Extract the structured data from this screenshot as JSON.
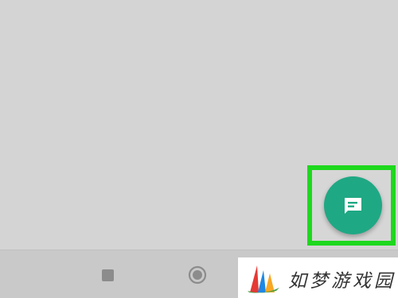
{
  "screen": {
    "background_color": "#d3d3d3"
  },
  "nav_bar": {
    "recents_icon": "square-icon",
    "home_icon": "circle-icon"
  },
  "fab": {
    "icon": "new-message-icon",
    "color": "#1fa884",
    "highlight_color": "#1ed81e"
  },
  "watermark": {
    "text": "如梦游戏园",
    "logo_icon": "sail-logo",
    "logo_colors": [
      "#e53935",
      "#f9a825",
      "#1e88e5",
      "#43a047"
    ]
  }
}
